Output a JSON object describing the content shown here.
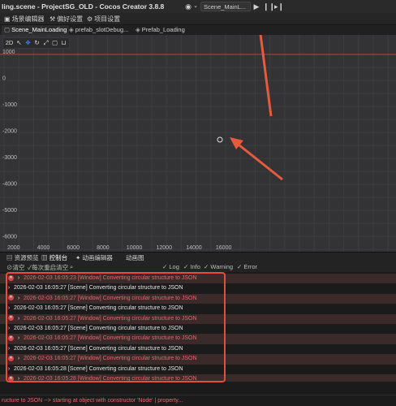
{
  "window": {
    "title": "ling.scene - ProjectSG_OLD - Cocos Creator 3.8.8",
    "scene_select": "Scene_MainL...",
    "play_icon": "play-icon",
    "pause_icon": "pause-icon",
    "step_icon": "step-icon"
  },
  "menu": {
    "items": [
      "场景编辑器",
      "偏好设置",
      "项目设置"
    ]
  },
  "tabs": [
    "Scene_MainLoading",
    "prefab_slotDebug...",
    "Prefab_Loading"
  ],
  "scene": {
    "toolbar_label": "2D",
    "y_labels": [
      "1000",
      "0",
      "-1000",
      "-2000",
      "-3000",
      "-4000",
      "-5000",
      "-6000",
      "-7000"
    ],
    "x_labels": [
      "2000",
      "4000",
      "6000",
      "8000",
      "10000",
      "12000",
      "14000",
      "16000"
    ]
  },
  "bottom_tabs": [
    "资源预览",
    "控制台",
    "动画编辑器",
    "动画图"
  ],
  "console_toolbar": [
    "清空",
    "每次重启清空",
    "Log",
    "Info",
    "Warning",
    "Error"
  ],
  "logs": [
    {
      "type": "error",
      "text": "2026-02-03 16:05:23 [Window] Converting circular structure to JSON"
    },
    {
      "type": "plain",
      "text": "2026-02-03 16:05:27 [Scene] Converting circular structure to JSON"
    },
    {
      "type": "error",
      "text": "2026-02-03 16:05:27 [Window] Converting circular structure to JSON"
    },
    {
      "type": "plain",
      "text": "2026-02-03 16:05:27 [Scene] Converting circular structure to JSON"
    },
    {
      "type": "error",
      "text": "2026-02-03 16:05:27 [Window] Converting circular structure to JSON"
    },
    {
      "type": "plain",
      "text": "2026-02-03 16:05:27 [Scene] Converting circular structure to JSON"
    },
    {
      "type": "error",
      "text": "2026-02-03 16:05:27 [Window] Converting circular structure to JSON"
    },
    {
      "type": "plain",
      "text": "2026-02-03 16:05:27 [Scene] Converting circular structure to JSON"
    },
    {
      "type": "error",
      "text": "2026-02-03 16:05:27 [Window] Converting circular structure to JSON"
    },
    {
      "type": "plain",
      "text": "2026-02-03 16:05:28 [Scene] Converting circular structure to JSON"
    },
    {
      "type": "error",
      "text": "2026-02-03 16:05:28 [Window] Converting circular structure to JSON"
    }
  ],
  "status_text": "ructure to JSON --> starting at object with constructor 'Node' | property...",
  "colors": {
    "accent": "#3b8be0",
    "error": "#e26a6a",
    "annotation": "#e74c3c"
  }
}
